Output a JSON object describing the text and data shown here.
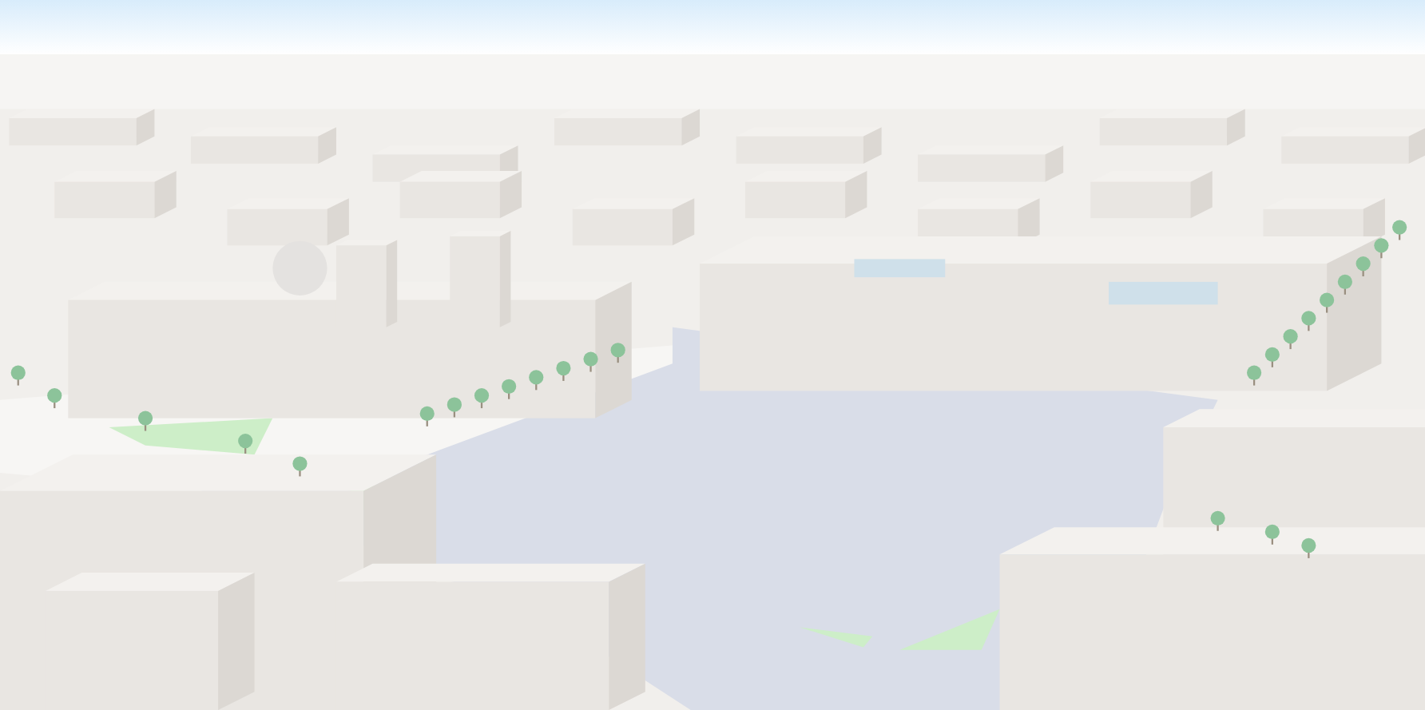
{
  "map": {
    "kind": "city"
  }
}
